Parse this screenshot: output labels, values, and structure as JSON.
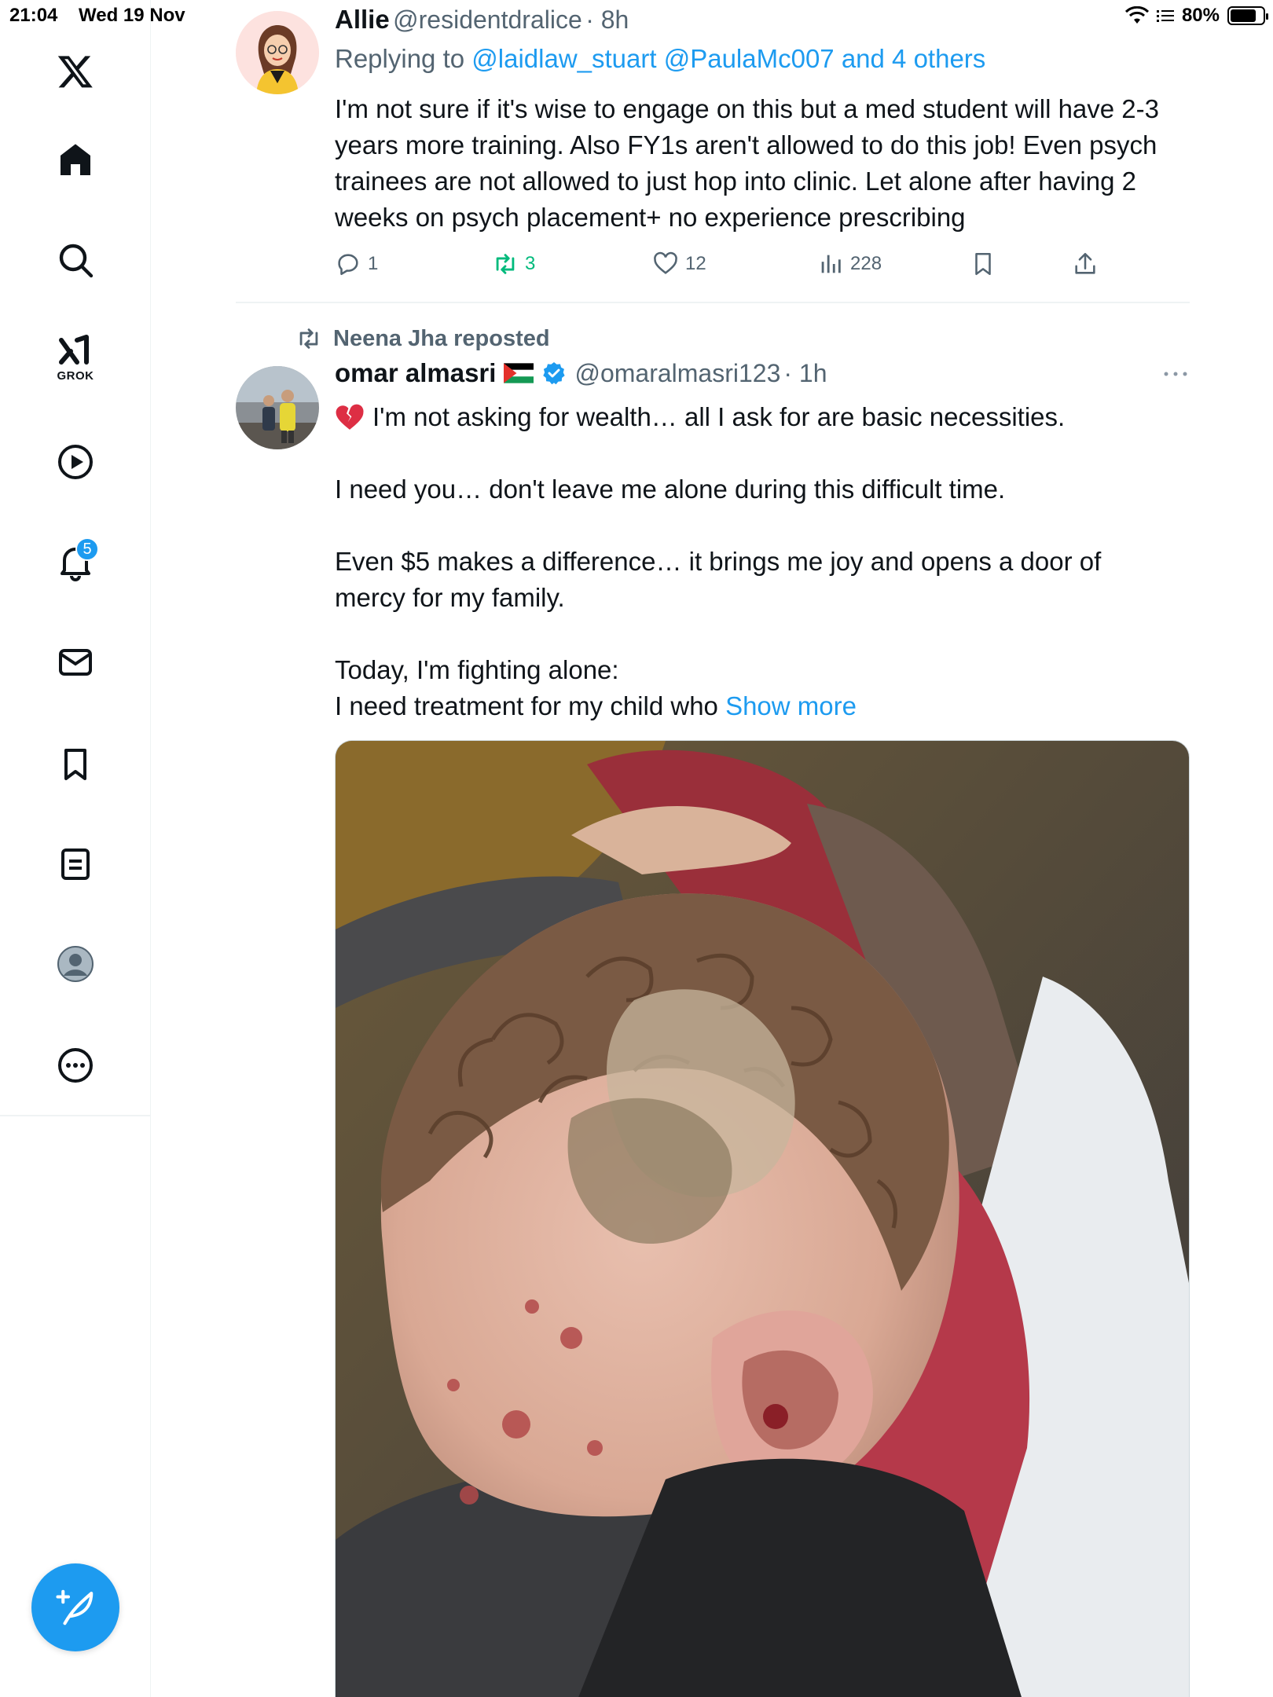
{
  "status_bar": {
    "time": "21:04",
    "date": "Wed 19 Nov",
    "battery": "80%",
    "battery_level": 0.8
  },
  "sidebar": {
    "grok_label": "GROK",
    "notifications_badge": "5"
  },
  "tweet1": {
    "name": "Allie",
    "handle": "@residentdralice",
    "time": "· 8h",
    "replying_prefix": "Replying to ",
    "replying_to": "@laidlaw_stuart @PaulaMc007 and 4 others",
    "lines": [
      "I'm not sure if it's wise to engage on this but a med student will have 2-3",
      "years more training. Also FY1s aren't allowed to do this job! Even psych",
      "trainees are not allowed to just hop into clinic. Let alone after having 2",
      "weeks on psych placement+ no experience prescribing"
    ],
    "replies": "1",
    "reposts": "3",
    "likes": "12",
    "views": "228"
  },
  "tweet2": {
    "reposted_by": "Neena Jha reposted",
    "name": "omar almasri",
    "handle": "@omaralmasri123",
    "time": "· 1h",
    "p1": "I'm not asking for wealth… all I ask for are basic necessities.",
    "p2": "I need you… don't leave me alone during this difficult time.",
    "p3a": "Even $5 makes a difference… it brings me joy and opens a door of",
    "p3b": "mercy for my family.",
    "p4a": "Today, I'm fighting alone:",
    "p4b": "I need treatment for my child who ",
    "show_more": "Show more"
  },
  "colors": {
    "accent": "#1d9bf0",
    "retweet_green": "#00ba7c",
    "secondary_text": "#536471"
  }
}
